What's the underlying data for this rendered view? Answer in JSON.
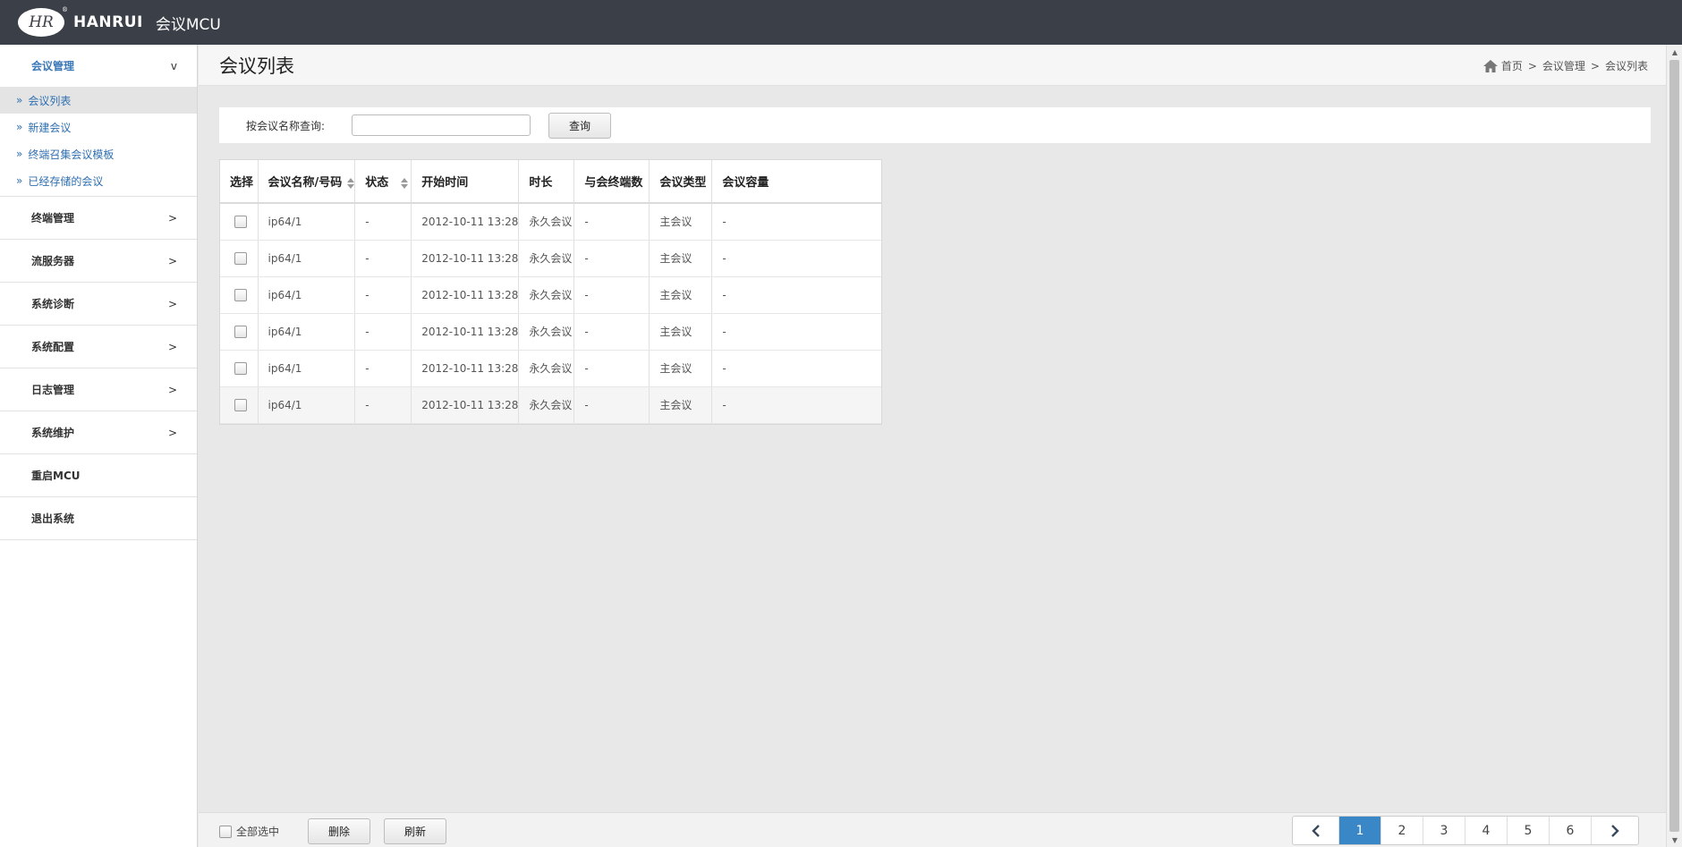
{
  "header": {
    "logo_mark": "HR",
    "logo_reg": "®",
    "brand": "HANRUI",
    "app_title": "会议MCU"
  },
  "sidebar": {
    "groups": [
      {
        "label": "会议管理",
        "chevron": "v",
        "open": true
      },
      {
        "label": "终端管理",
        "chevron": ">"
      },
      {
        "label": "流服务器",
        "chevron": ">"
      },
      {
        "label": "系统诊断",
        "chevron": ">"
      },
      {
        "label": "系统配置",
        "chevron": ">"
      },
      {
        "label": "日志管理",
        "chevron": ">"
      },
      {
        "label": "系统维护",
        "chevron": ">"
      },
      {
        "label": "重启MCU"
      },
      {
        "label": "退出系统"
      }
    ],
    "sub_marker": "»",
    "sub_items": [
      {
        "label": "会议列表",
        "active": true
      },
      {
        "label": "新建会议"
      },
      {
        "label": "终端召集会议模板"
      },
      {
        "label": "已经存储的会议"
      }
    ]
  },
  "page": {
    "title": "会议列表",
    "breadcrumb": [
      "首页",
      "会议管理",
      "会议列表"
    ],
    "breadcrumb_sep": ">"
  },
  "search": {
    "label": "按会议名称查询:",
    "value": "",
    "placeholder": "",
    "button": "查询"
  },
  "table": {
    "columns": [
      "选择",
      "会议名称/号码",
      "状态",
      "开始时间",
      "时长",
      "与会终端数",
      "会议类型",
      "会议容量"
    ],
    "rows": [
      {
        "name": "ip64/1",
        "status": "-",
        "start": "2012-10-11 13:28",
        "duration": "永久会议",
        "terminals": "-",
        "type": "主会议",
        "capacity": "-"
      },
      {
        "name": "ip64/1",
        "status": "-",
        "start": "2012-10-11 13:28",
        "duration": "永久会议",
        "terminals": "-",
        "type": "主会议",
        "capacity": "-"
      },
      {
        "name": "ip64/1",
        "status": "-",
        "start": "2012-10-11 13:28",
        "duration": "永久会议",
        "terminals": "-",
        "type": "主会议",
        "capacity": "-"
      },
      {
        "name": "ip64/1",
        "status": "-",
        "start": "2012-10-11 13:28",
        "duration": "永久会议",
        "terminals": "-",
        "type": "主会议",
        "capacity": "-"
      },
      {
        "name": "ip64/1",
        "status": "-",
        "start": "2012-10-11 13:28",
        "duration": "永久会议",
        "terminals": "-",
        "type": "主会议",
        "capacity": "-"
      },
      {
        "name": "ip64/1",
        "status": "-",
        "start": "2012-10-11 13:28",
        "duration": "永久会议",
        "terminals": "-",
        "type": "主会议",
        "capacity": "-"
      }
    ]
  },
  "footer": {
    "select_all": "全部选中",
    "delete": "删除",
    "refresh": "刷新",
    "pages": [
      "1",
      "2",
      "3",
      "4",
      "5",
      "6"
    ],
    "current_page": "1",
    "prev_icon": "chevron-left-icon",
    "next_icon": "chevron-right-icon"
  },
  "colors": {
    "topbar": "#3b3f48",
    "accent": "#3a87c8",
    "link": "#2f6fb0"
  }
}
